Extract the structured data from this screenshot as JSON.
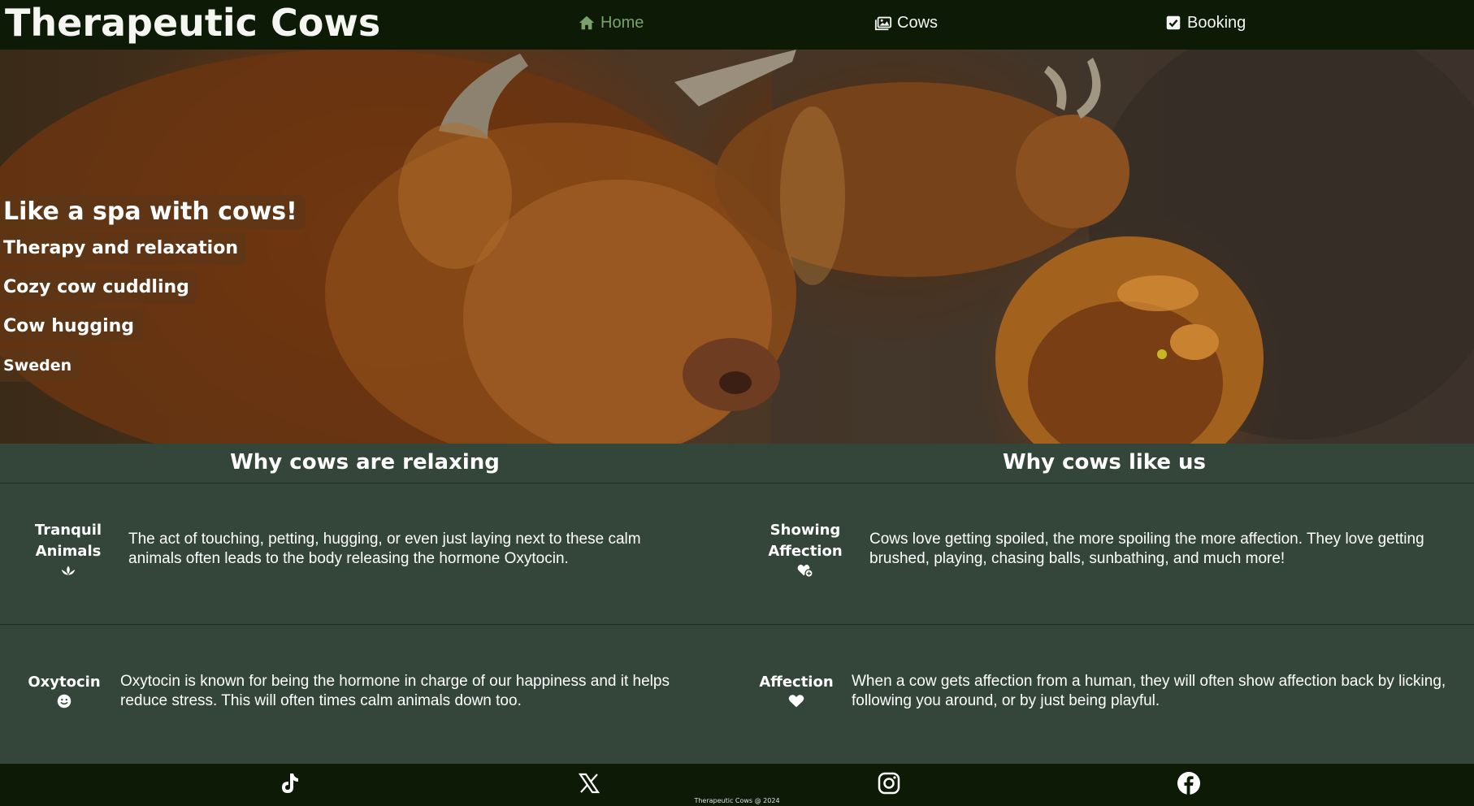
{
  "header": {
    "title": "Therapeutic Cows",
    "nav": [
      {
        "label": "Home",
        "icon": "home-icon",
        "active": true
      },
      {
        "label": "Cows",
        "icon": "image-icon",
        "active": false
      },
      {
        "label": "Booking",
        "icon": "check-square-icon",
        "active": false
      }
    ]
  },
  "hero": {
    "tags": [
      "Like a spa with cows!",
      "Therapy and relaxation",
      "Cozy cow cuddling",
      "Cow hugging",
      "Sweden"
    ]
  },
  "sections": {
    "left_title": "Why cows are relaxing",
    "right_title": "Why cows like us"
  },
  "features": [
    {
      "label_line1": "Tranquil",
      "label_line2": "Animals",
      "icon": "lotus-icon",
      "text": "The act of touching, petting, hugging, or even just laying next to these calm animals often leads to the body releasing the hormone Oxytocin."
    },
    {
      "label_line1": "Showing",
      "label_line2": "Affection",
      "icon": "heart-plus-icon",
      "text": "Cows love getting spoiled, the more spoiling the more affection. They love getting brushed, playing, chasing balls, sunbathing, and much more!"
    },
    {
      "label_line1": "Oxytocin",
      "label_line2": "",
      "icon": "smile-icon",
      "text": "Oxytocin is known for being the hormone in charge of our happiness and it helps reduce stress. This will often times calm animals down too."
    },
    {
      "label_line1": "Affection",
      "label_line2": "",
      "icon": "heart-icon",
      "text": "When a cow gets affection from a human, they will often show affection back by licking, following you around, or by just being playful."
    }
  ],
  "footer": {
    "social": [
      "tiktok-icon",
      "x-icon",
      "instagram-icon",
      "facebook-icon"
    ],
    "copyright": "Therapeutic Cows @ 2024"
  },
  "colors": {
    "header_bg": "#0c1a06",
    "body_bg": "#344639",
    "active_nav": "#7aa06b"
  }
}
